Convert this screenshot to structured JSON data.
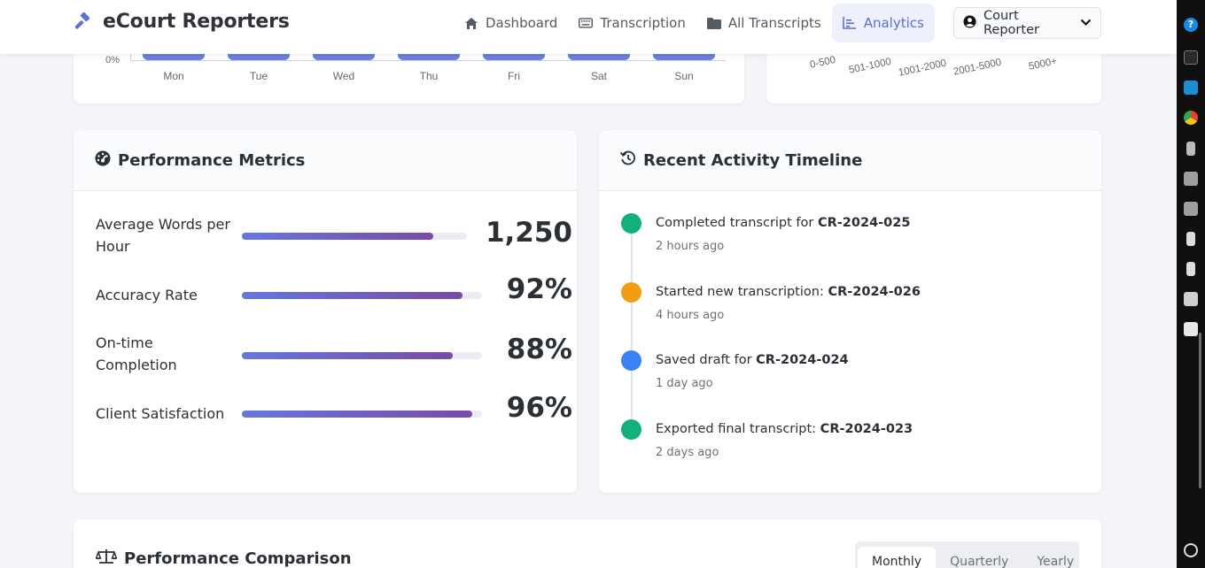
{
  "app": {
    "name": "eCourt Reporters"
  },
  "nav": {
    "items": [
      {
        "label": "Dashboard",
        "icon": "home-icon"
      },
      {
        "label": "Transcription",
        "icon": "keyboard-icon"
      },
      {
        "label": "All Transcripts",
        "icon": "folder-icon"
      },
      {
        "label": "Analytics",
        "icon": "chart-line-icon",
        "active": true
      }
    ],
    "user_label": "Court Reporter"
  },
  "daily_chart": {
    "y_tick": "0%",
    "days": [
      "Mon",
      "Tue",
      "Wed",
      "Thu",
      "Fri",
      "Sat",
      "Sun"
    ]
  },
  "range_chart": {
    "labels": [
      "0-500",
      "501-1000",
      "1001-2000",
      "2001-5000",
      "5000+"
    ]
  },
  "performance": {
    "title": "Performance Metrics",
    "metrics": [
      {
        "label": "Average Words per Hour",
        "value": "1,250",
        "progress": 0.85
      },
      {
        "label": "Accuracy Rate",
        "value": "92%",
        "progress": 0.92
      },
      {
        "label": "On-time Completion",
        "value": "88%",
        "progress": 0.88
      },
      {
        "label": "Client Satisfaction",
        "value": "96%",
        "progress": 0.96
      }
    ]
  },
  "timeline": {
    "title": "Recent Activity Timeline",
    "items": [
      {
        "text": "Completed transcript for ",
        "case": "CR-2024-025",
        "time": "2 hours ago",
        "color": "#12b07a"
      },
      {
        "text": "Started new transcription: ",
        "case": "CR-2024-026",
        "time": "4 hours ago",
        "color": "#f29d12"
      },
      {
        "text": "Saved draft for ",
        "case": "CR-2024-024",
        "time": "1 day ago",
        "color": "#3b82f6"
      },
      {
        "text": "Exported final transcript: ",
        "case": "CR-2024-023",
        "time": "2 days ago",
        "color": "#12b07a"
      }
    ]
  },
  "comparison": {
    "title": "Performance Comparison",
    "tabs": [
      {
        "label": "Monthly",
        "active": true
      },
      {
        "label": "Quarterly",
        "active": false
      },
      {
        "label": "Yearly",
        "active": false
      }
    ]
  },
  "colors": {
    "accent": "#5a6fd8",
    "bar": "#6b7fdb",
    "gradient_start": "#6677dd",
    "gradient_end": "#7a4aa8"
  }
}
